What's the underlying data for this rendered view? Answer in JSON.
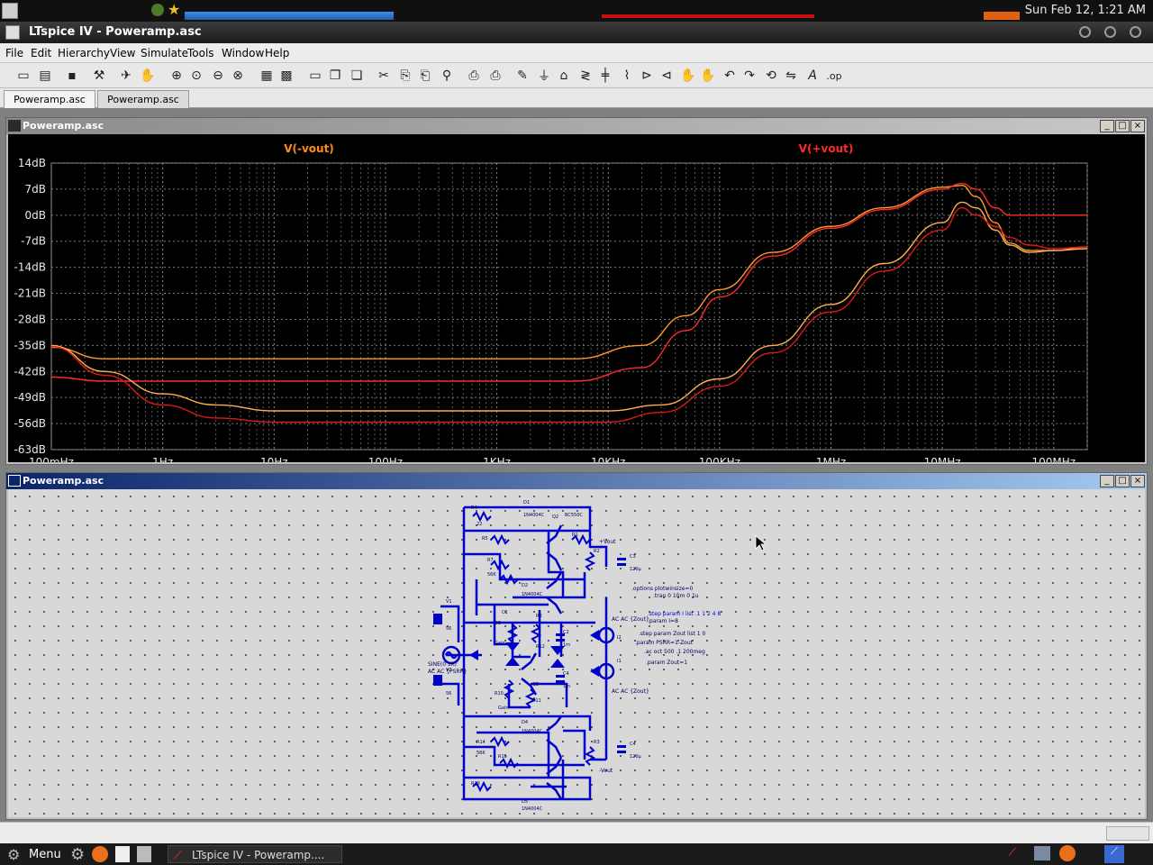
{
  "system": {
    "clock": "Sun Feb 12,  1:21 AM",
    "taskbar_menu": "Menu",
    "taskbar_task": "LTspice IV - Poweramp...."
  },
  "window": {
    "title": "LTspice IV - Poweramp.asc"
  },
  "menu": [
    "File",
    "Edit",
    "Hierarchy",
    "View",
    "Simulate",
    "Tools",
    "Window",
    "Help"
  ],
  "tabs": [
    "Poweramp.asc",
    "Poweramp.asc"
  ],
  "plot_window": {
    "title": "Poweramp.asc"
  },
  "schematic_window": {
    "title": "Poweramp.asc",
    "directives": [
      ".options plotwinsize=0",
      ".tran 0 10m 0 1u",
      ".step param I list .1 1 2 4 8",
      ".param I=8",
      ".step param Zout list 1 0",
      ".param PSRR=1-Zout",
      ".ac oct 500 .1 200meg",
      ".param Zout=1"
    ],
    "source_labels": [
      "AC AC {Zout}",
      "AC AC {Zout}",
      "SINE(0 1K)",
      "AC AC {PSRR}"
    ],
    "net_labels": [
      "+Vout",
      "-Vout"
    ]
  },
  "chart_data": {
    "type": "line",
    "x_scale": "log",
    "xlim": [
      0.1,
      200000000
    ],
    "ylim": [
      -63,
      14
    ],
    "grid": true,
    "y_ticks": [
      "14dB",
      "7dB",
      "0dB",
      "-7dB",
      "-14dB",
      "-21dB",
      "-28dB",
      "-35dB",
      "-42dB",
      "-49dB",
      "-56dB",
      "-63dB"
    ],
    "x_ticks": [
      "100mHz",
      "1Hz",
      "10Hz",
      "100Hz",
      "1KHz",
      "10KHz",
      "100KHz",
      "1MHz",
      "10MHz",
      "100MHz"
    ],
    "trace_labels": [
      {
        "text": "V(-vout)",
        "color": "#ff8c1a"
      },
      {
        "text": "V(+vout)",
        "color": "#ff2a2a"
      }
    ],
    "series": [
      {
        "color": "#ff9a2a",
        "points": [
          [
            0.1,
            -35.5
          ],
          [
            0.3,
            -38.6
          ],
          [
            1,
            -38.6
          ],
          [
            10,
            -38.6
          ],
          [
            100,
            -38.6
          ],
          [
            1000,
            -38.6
          ],
          [
            5000,
            -38.6
          ],
          [
            20000,
            -35
          ],
          [
            50000,
            -27
          ],
          [
            100000,
            -20
          ],
          [
            300000,
            -10
          ],
          [
            1000000,
            -3
          ],
          [
            3000000,
            2
          ],
          [
            10000000,
            7.5
          ],
          [
            15000000,
            8
          ],
          [
            20000000,
            5
          ],
          [
            30000000,
            -2
          ],
          [
            40000000,
            -7.5
          ],
          [
            60000000,
            -9.5
          ],
          [
            100000000,
            -9.5
          ],
          [
            200000000,
            -8.5
          ]
        ]
      },
      {
        "color": "#ff2a2a",
        "points": [
          [
            0.1,
            -43.5
          ],
          [
            0.3,
            -44.6
          ],
          [
            1,
            -44.6
          ],
          [
            10,
            -44.6
          ],
          [
            100,
            -44.6
          ],
          [
            1000,
            -44.6
          ],
          [
            5000,
            -44.6
          ],
          [
            20000,
            -41
          ],
          [
            50000,
            -31
          ],
          [
            100000,
            -22
          ],
          [
            300000,
            -11
          ],
          [
            1000000,
            -3.5
          ],
          [
            3000000,
            1.5
          ],
          [
            10000000,
            7
          ],
          [
            15000000,
            8.5
          ],
          [
            20000000,
            7
          ],
          [
            30000000,
            2
          ],
          [
            40000000,
            0
          ],
          [
            60000000,
            0
          ],
          [
            100000000,
            0
          ],
          [
            200000000,
            0
          ]
        ]
      },
      {
        "color": "#ffb050",
        "points": [
          [
            0.1,
            -35
          ],
          [
            0.3,
            -42
          ],
          [
            1,
            -48
          ],
          [
            3,
            -51
          ],
          [
            10,
            -52.6
          ],
          [
            100,
            -52.6
          ],
          [
            1000,
            -52.6
          ],
          [
            10000,
            -52.6
          ],
          [
            30000,
            -51
          ],
          [
            100000,
            -44
          ],
          [
            300000,
            -35
          ],
          [
            1000000,
            -24
          ],
          [
            3000000,
            -13
          ],
          [
            10000000,
            -2
          ],
          [
            15000000,
            3.5
          ],
          [
            20000000,
            2
          ],
          [
            30000000,
            -4
          ],
          [
            40000000,
            -8
          ],
          [
            60000000,
            -10
          ],
          [
            100000000,
            -9.5
          ],
          [
            200000000,
            -9
          ]
        ]
      },
      {
        "color": "#e01818",
        "points": [
          [
            0.1,
            -35.3
          ],
          [
            0.3,
            -43
          ],
          [
            1,
            -51
          ],
          [
            3,
            -54.5
          ],
          [
            10,
            -55.6
          ],
          [
            100,
            -55.6
          ],
          [
            1000,
            -55.6
          ],
          [
            10000,
            -55.6
          ],
          [
            30000,
            -53
          ],
          [
            100000,
            -46
          ],
          [
            300000,
            -37
          ],
          [
            1000000,
            -26
          ],
          [
            3000000,
            -15
          ],
          [
            10000000,
            -4
          ],
          [
            15000000,
            2
          ],
          [
            20000000,
            0
          ],
          [
            30000000,
            -3
          ],
          [
            40000000,
            -6
          ],
          [
            60000000,
            -8
          ],
          [
            100000000,
            -9
          ],
          [
            200000000,
            -8.5
          ]
        ]
      }
    ]
  }
}
